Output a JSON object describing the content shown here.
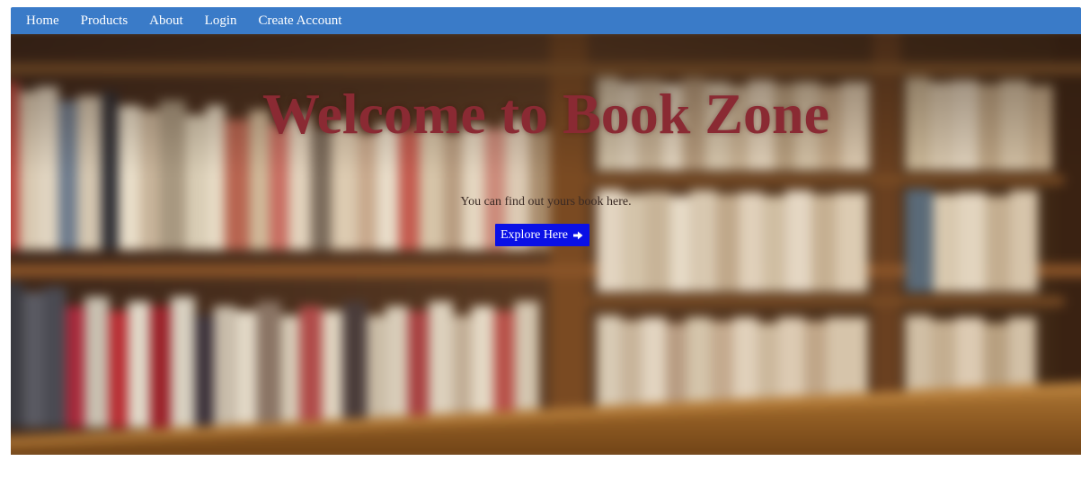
{
  "nav": {
    "items": [
      {
        "label": "Home"
      },
      {
        "label": "Products"
      },
      {
        "label": "About"
      },
      {
        "label": "Login"
      },
      {
        "label": "Create Account"
      }
    ]
  },
  "hero": {
    "title": "Welcome to Book Zone",
    "subtitle": "You can find out yours book here.",
    "button_label": "Explore Here",
    "button_icon": "arrow-right-circle-icon",
    "background": "blurred-bookshelf-photo"
  },
  "colors": {
    "navbar": "#3a7bc8",
    "title": "#8a2a33",
    "button": "#0a10e6"
  }
}
